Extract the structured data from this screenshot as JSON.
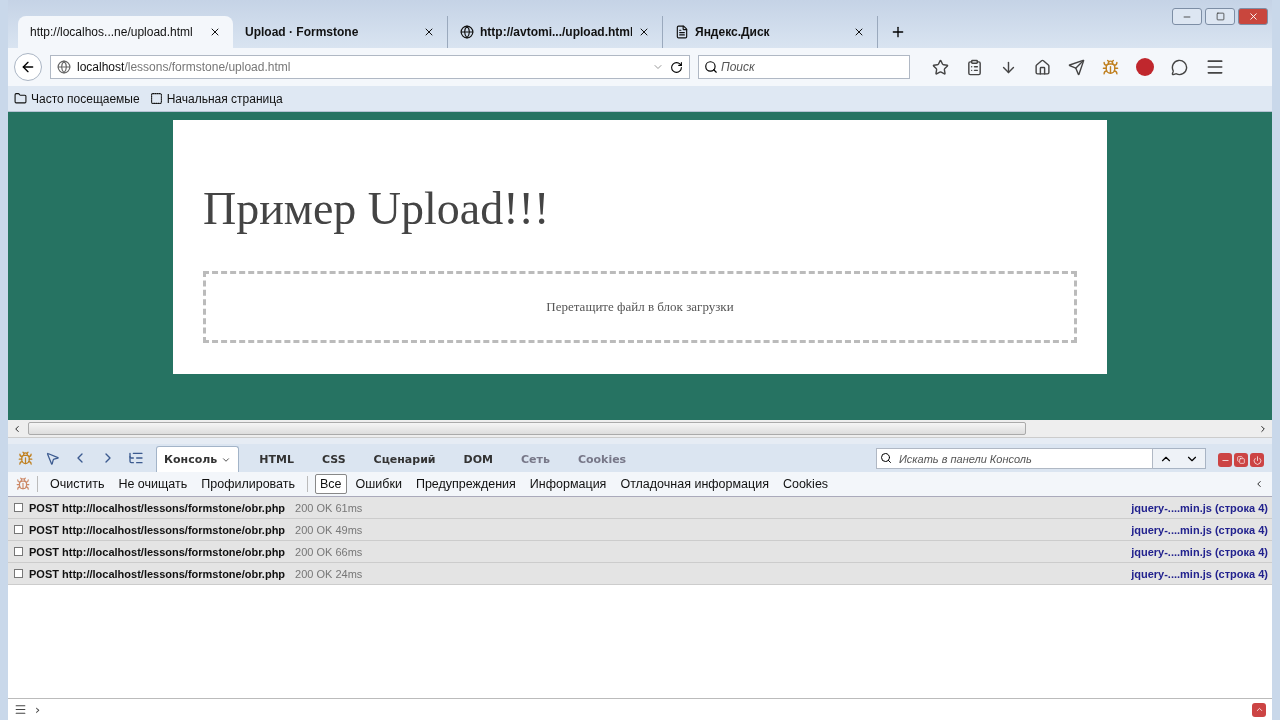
{
  "tabs": [
    {
      "label": "http://localhos...ne/upload.html",
      "selected": true,
      "kind": "plain"
    },
    {
      "label": "Upload · Formstone",
      "selected": false,
      "kind": "plain"
    },
    {
      "label": "http://avtomi.../upload.html",
      "selected": false,
      "kind": "globe"
    },
    {
      "label": "Яндекс.Диск",
      "selected": false,
      "kind": "page"
    }
  ],
  "address": {
    "host": "localhost",
    "path": "/lessons/formstone/upload.html"
  },
  "search": {
    "placeholder": "Поиск"
  },
  "bookmarks": [
    {
      "label": "Часто посещаемые",
      "kind": "folder"
    },
    {
      "label": "Начальная страница",
      "kind": "page"
    }
  ],
  "page": {
    "heading": "Пример Upload!!!",
    "dropzone": "Перетащите файл в блок загрузки"
  },
  "devtools": {
    "tabs": [
      {
        "label": "Консоль",
        "selected": true,
        "disabled": false
      },
      {
        "label": "HTML",
        "selected": false,
        "disabled": false
      },
      {
        "label": "CSS",
        "selected": false,
        "disabled": false
      },
      {
        "label": "Сценарий",
        "selected": false,
        "disabled": false
      },
      {
        "label": "DOM",
        "selected": false,
        "disabled": false
      },
      {
        "label": "Сеть",
        "selected": false,
        "disabled": true
      },
      {
        "label": "Cookies",
        "selected": false,
        "disabled": true
      }
    ],
    "search": {
      "placeholder": "Искать в панели Консоль"
    },
    "actions": [
      "Очистить",
      "Не очищать",
      "Профилировать"
    ],
    "filters": [
      {
        "label": "Все",
        "selected": true
      },
      {
        "label": "Ошибки",
        "selected": false
      },
      {
        "label": "Предупреждения",
        "selected": false
      },
      {
        "label": "Информация",
        "selected": false
      },
      {
        "label": "Отладочная информация",
        "selected": false
      },
      {
        "label": "Cookies",
        "selected": false
      }
    ],
    "log": [
      {
        "request": "POST http://localhost/lessons/formstone/obr.php",
        "status": "200 OK 61ms",
        "source": "jquery-....min.js (строка 4)"
      },
      {
        "request": "POST http://localhost/lessons/formstone/obr.php",
        "status": "200 OK 49ms",
        "source": "jquery-....min.js (строка 4)"
      },
      {
        "request": "POST http://localhost/lessons/formstone/obr.php",
        "status": "200 OK 66ms",
        "source": "jquery-....min.js (строка 4)"
      },
      {
        "request": "POST http://localhost/lessons/formstone/obr.php",
        "status": "200 OK 24ms",
        "source": "jquery-....min.js (строка 4)"
      }
    ],
    "prompt": "›"
  }
}
